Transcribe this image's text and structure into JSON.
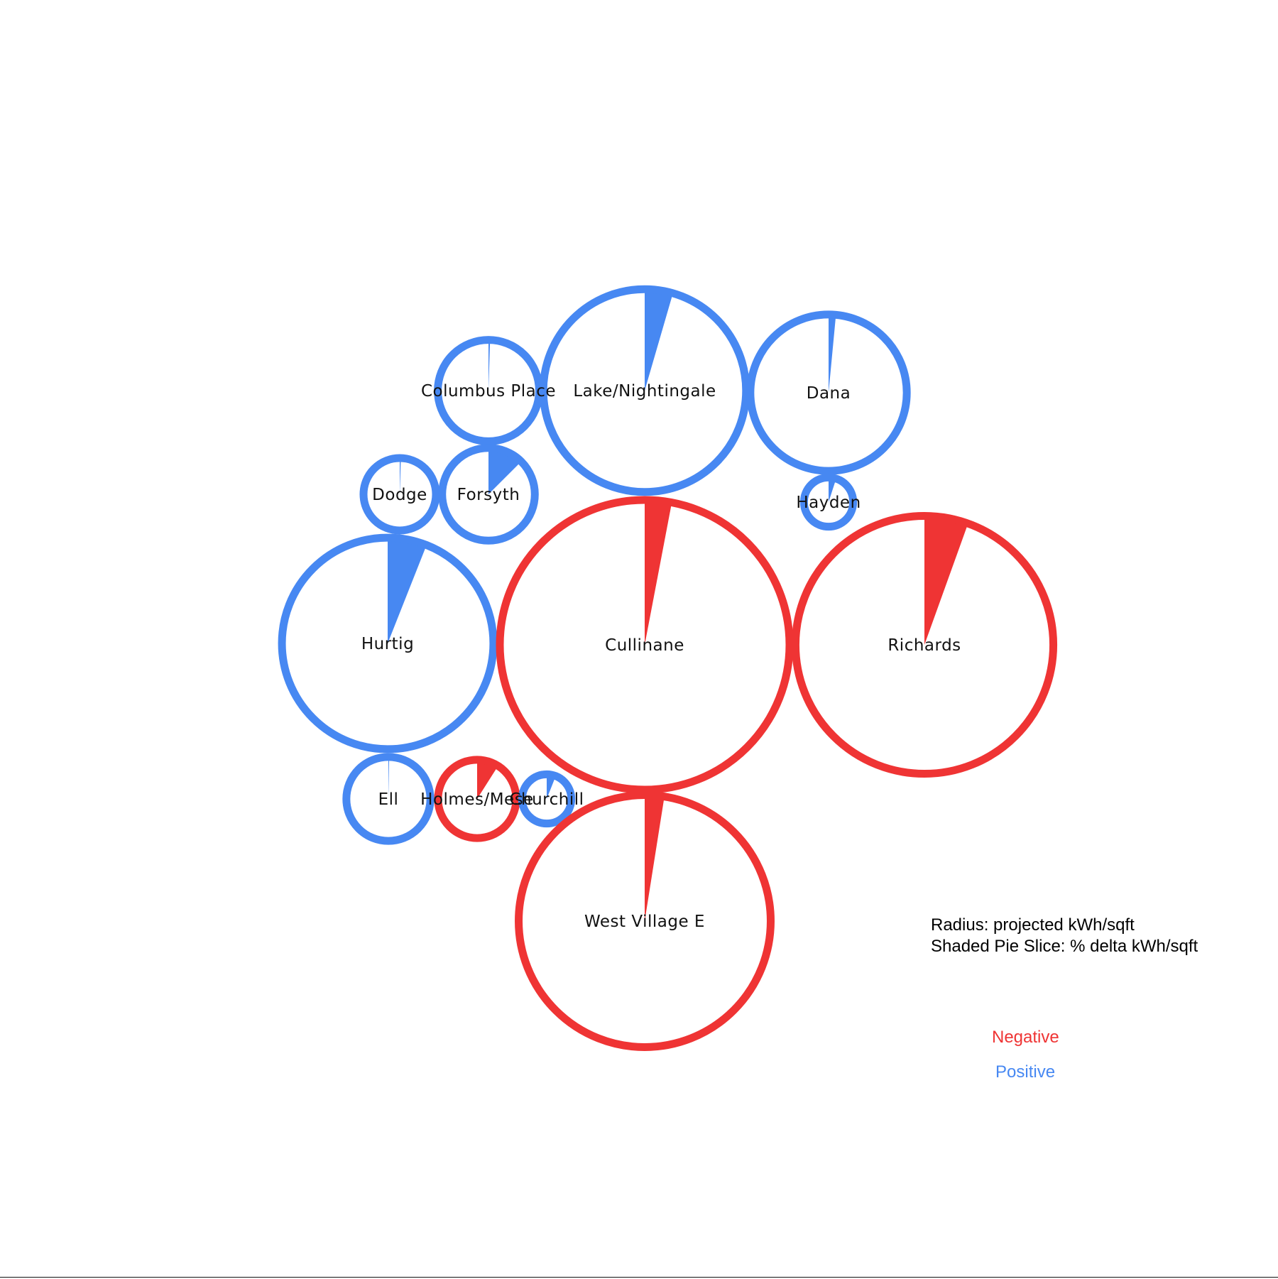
{
  "chart_data": {
    "type": "bubble-pie",
    "colors": {
      "negative": "#ef3434",
      "positive": "#4788f2"
    },
    "legend": {
      "radius_text": "Radius: projected kWh/sqft",
      "slice_text": "Shaded Pie Slice: % delta kWh/sqft",
      "negative_label": "Negative",
      "positive_label": "Positive"
    },
    "encoding": {
      "radius": "projected kWh/sqft (relative)",
      "slice": "% delta kWh/sqft"
    },
    "buildings": [
      {
        "name": "Columbus Place",
        "radius_rel": 0.35,
        "delta_pct": 0.5,
        "sign": "positive"
      },
      {
        "name": "Lake/Nightingale",
        "radius_rel": 0.7,
        "delta_pct": 4.5,
        "sign": "positive"
      },
      {
        "name": "Dana",
        "radius_rel": 0.54,
        "delta_pct": 1.5,
        "sign": "positive"
      },
      {
        "name": "Dodge",
        "radius_rel": 0.25,
        "delta_pct": 0.5,
        "sign": "positive"
      },
      {
        "name": "Forsyth",
        "radius_rel": 0.32,
        "delta_pct": 12.5,
        "sign": "positive"
      },
      {
        "name": "Hayden",
        "radius_rel": 0.17,
        "delta_pct": 5.0,
        "sign": "positive"
      },
      {
        "name": "Hurtig",
        "radius_rel": 0.73,
        "delta_pct": 6.0,
        "sign": "positive"
      },
      {
        "name": "Cullinane",
        "radius_rel": 1.0,
        "delta_pct": 3.0,
        "sign": "negative"
      },
      {
        "name": "Richards",
        "radius_rel": 0.89,
        "delta_pct": 5.5,
        "sign": "negative"
      },
      {
        "name": "Ell",
        "radius_rel": 0.29,
        "delta_pct": 0.3,
        "sign": "positive"
      },
      {
        "name": "Holmes/Mese",
        "radius_rel": 0.27,
        "delta_pct": 9.0,
        "sign": "negative"
      },
      {
        "name": "Churchill",
        "radius_rel": 0.17,
        "delta_pct": 6.0,
        "sign": "positive"
      },
      {
        "name": "West Village E",
        "radius_rel": 0.87,
        "delta_pct": 2.5,
        "sign": "negative"
      }
    ]
  }
}
